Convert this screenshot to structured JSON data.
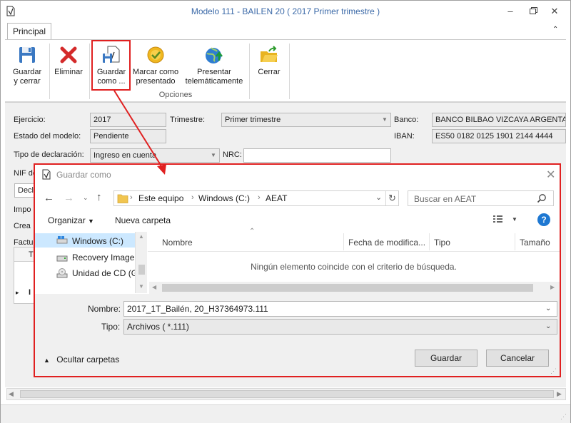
{
  "window": {
    "title": "Modelo 111 - BAILEN 20 ( 2017 Primer trimestre )"
  },
  "ribbon": {
    "tab": "Principal",
    "buttons": [
      {
        "label1": "Guardar",
        "label2": "y cerrar"
      },
      {
        "label1": "Eliminar",
        "label2": ""
      },
      {
        "label1": "Guardar",
        "label2": "como ..."
      },
      {
        "label1": "Marcar como",
        "label2": "presentado"
      },
      {
        "label1": "Presentar",
        "label2": "telemáticamente"
      },
      {
        "label1": "Cerrar",
        "label2": ""
      }
    ],
    "group": "Opciones"
  },
  "form": {
    "ejercicio_label": "Ejercicio:",
    "ejercicio_value": "2017",
    "trimestre_label": "Trimestre:",
    "trimestre_value": "Primer trimestre",
    "banco_label": "Banco:",
    "banco_value": "BANCO BILBAO VIZCAYA ARGENTARIA",
    "estado_label": "Estado del modelo:",
    "estado_value": "Pendiente",
    "iban_label": "IBAN:",
    "iban_value": "ES50 0182 0125 1901 2144 4444",
    "tipo_label": "Tipo de declaración:",
    "tipo_value": "Ingreso en cuenta",
    "nrc_label": "NRC:",
    "nrc_value": "",
    "nif_label": "NIF de",
    "decl_label": "Decla",
    "impo_label": "Impo",
    "crea_label": "Crea",
    "factu_label": "Factu",
    "grid_col_t": "T",
    "grid_row_marker": "▸",
    "grid_row_i": "I"
  },
  "dialog": {
    "title": "Guardar como",
    "breadcrumb": [
      "Este equipo",
      "Windows (C:)",
      "AEAT"
    ],
    "search_placeholder": "Buscar en AEAT",
    "organize": "Organizar",
    "new_folder": "Nueva carpeta",
    "nav_items": [
      "Windows (C:)",
      "Recovery Image",
      "Unidad de CD (G"
    ],
    "columns": [
      "Nombre",
      "Fecha de modifica...",
      "Tipo",
      "Tamaño"
    ],
    "empty_message": "Ningún elemento coincide con el criterio de búsqueda.",
    "name_label": "Nombre:",
    "name_value": "2017_1T_Bailén, 20_H37364973.111",
    "type_label": "Tipo:",
    "type_value": "Archivos  ( *.111)",
    "hide_folders": "Ocultar carpetas",
    "save_button": "Guardar",
    "cancel_button": "Cancelar"
  },
  "colors": {
    "title_blue": "#3c6aa8",
    "highlight_red": "#e02020",
    "selected_nav": "#cce8ff"
  }
}
